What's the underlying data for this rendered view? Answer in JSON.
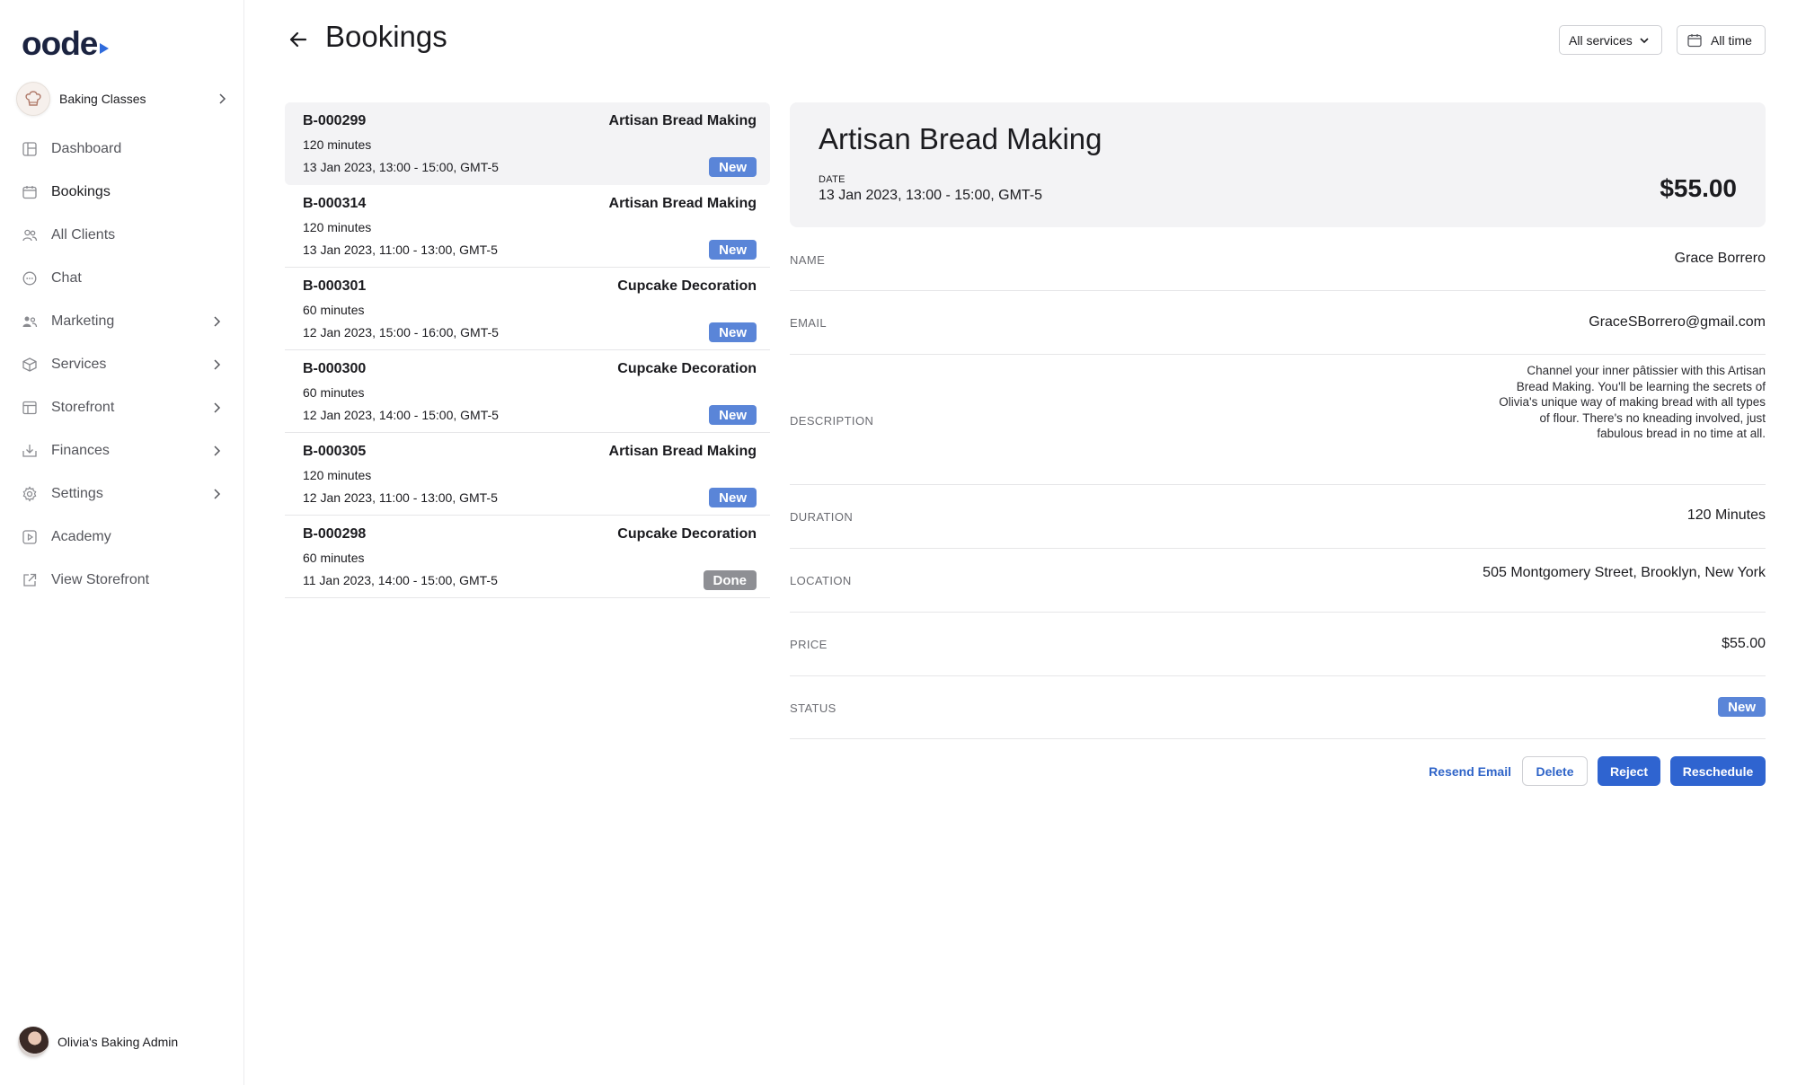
{
  "app": {
    "logo_text": "oode"
  },
  "org": {
    "name": "Baking Classes"
  },
  "sidebar": {
    "items": [
      {
        "label": "Dashboard",
        "icon": "dashboard-icon",
        "has_chevron": false
      },
      {
        "label": "Bookings",
        "icon": "calendar-icon",
        "has_chevron": false,
        "active": true
      },
      {
        "label": "All Clients",
        "icon": "clients-icon",
        "has_chevron": false
      },
      {
        "label": "Chat",
        "icon": "chat-icon",
        "has_chevron": false
      },
      {
        "label": "Marketing",
        "icon": "marketing-icon",
        "has_chevron": true
      },
      {
        "label": "Services",
        "icon": "box-icon",
        "has_chevron": true
      },
      {
        "label": "Storefront",
        "icon": "storefront-icon",
        "has_chevron": true
      },
      {
        "label": "Finances",
        "icon": "finances-icon",
        "has_chevron": true
      },
      {
        "label": "Settings",
        "icon": "gear-icon",
        "has_chevron": true
      },
      {
        "label": "Academy",
        "icon": "play-icon",
        "has_chevron": false
      },
      {
        "label": "View Storefront",
        "icon": "external-link-icon",
        "has_chevron": false
      }
    ]
  },
  "user": {
    "name": "Olivia's Baking Admin"
  },
  "header": {
    "title": "Bookings",
    "services_filter": "All services",
    "time_filter": "All time"
  },
  "bookings": [
    {
      "id": "B-000299",
      "service": "Artisan Bread Making",
      "duration": "120 minutes",
      "datetime": "13 Jan 2023, 13:00 - 15:00, GMT-5",
      "status": "New"
    },
    {
      "id": "B-000314",
      "service": "Artisan Bread Making",
      "duration": "120 minutes",
      "datetime": "13 Jan 2023, 11:00 - 13:00, GMT-5",
      "status": "New"
    },
    {
      "id": "B-000301",
      "service": "Cupcake Decoration",
      "duration": "60 minutes",
      "datetime": "12 Jan 2023, 15:00 - 16:00, GMT-5",
      "status": "New"
    },
    {
      "id": "B-000300",
      "service": "Cupcake Decoration",
      "duration": "60 minutes",
      "datetime": "12 Jan 2023, 14:00 - 15:00, GMT-5",
      "status": "New"
    },
    {
      "id": "B-000305",
      "service": "Artisan Bread Making",
      "duration": "120 minutes",
      "datetime": "12 Jan 2023, 11:00 - 13:00, GMT-5",
      "status": "New"
    },
    {
      "id": "B-000298",
      "service": "Cupcake Decoration",
      "duration": "60 minutes",
      "datetime": "11 Jan 2023, 14:00 - 15:00, GMT-5",
      "status": "Done"
    }
  ],
  "detail": {
    "title": "Artisan Bread Making",
    "date_label": "DATE",
    "date_value": "13 Jan 2023, 13:00 - 15:00, GMT-5",
    "price_big": "$55.00",
    "name_label": "NAME",
    "name_value": "Grace Borrero",
    "email_label": "EMAIL",
    "email_value": "GraceSBorrero@gmail.com",
    "description_label": "DESCRIPTION",
    "description_value": "Channel your inner pâtissier with this Artisan Bread Making. You'll be learning the secrets of Olivia's unique way of making bread with all types of flour. There's no kneading involved, just fabulous bread in no time at all.",
    "duration_label": "DURATION",
    "duration_value": "120 Minutes",
    "location_label": "LOCATION",
    "location_value": "505 Montgomery Street, Brooklyn, New York",
    "price_label": "PRICE",
    "price_value": "$55.00",
    "status_label": "STATUS",
    "status_value": "New"
  },
  "actions": {
    "resend_email": "Resend Email",
    "delete": "Delete",
    "reject": "Reject",
    "reschedule": "Reschedule"
  },
  "colors": {
    "accent": "#2f64d0",
    "badge_new": "#5a85d8",
    "badge_done": "#8e8f94"
  }
}
